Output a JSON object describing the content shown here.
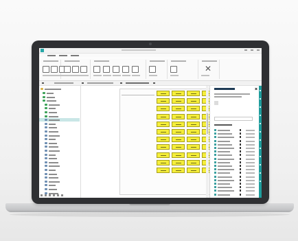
{
  "window": {
    "title": ""
  },
  "menu": {
    "items": [
      "",
      "",
      ""
    ]
  },
  "ribbon": {
    "groups": [
      {
        "label": "",
        "buttons": [
          "",
          "",
          ""
        ]
      },
      {
        "label": "",
        "buttons": [
          "",
          "",
          ""
        ]
      },
      {
        "label": "",
        "buttons": [
          "",
          "",
          "",
          "",
          ""
        ]
      },
      {
        "label": "",
        "buttons": [
          ""
        ]
      },
      {
        "label": "",
        "buttons": [
          ""
        ]
      },
      {
        "label": "",
        "buttons": [
          ""
        ]
      }
    ]
  },
  "address_bar": {
    "segments": [
      "",
      "",
      ""
    ]
  },
  "tree": {
    "root_label": "",
    "items": [
      "",
      "",
      "",
      "",
      "",
      "",
      "",
      "",
      "",
      "",
      "",
      "",
      "",
      "",
      "",
      "",
      "",
      "",
      "",
      "",
      "",
      "",
      "",
      "",
      "",
      "",
      ""
    ],
    "selected_index": 7
  },
  "canvas": {
    "grid_rows": 11,
    "grid_cols": 4,
    "cell_labels": []
  },
  "panel": {
    "title": "",
    "description": "",
    "search_placeholder": "",
    "section_heading": "",
    "rows": [
      {
        "label": "",
        "value": ""
      },
      {
        "label": "",
        "value": ""
      },
      {
        "label": "",
        "value": ""
      },
      {
        "label": "",
        "value": ""
      },
      {
        "label": "",
        "value": ""
      },
      {
        "label": "",
        "value": ""
      },
      {
        "label": "",
        "value": ""
      },
      {
        "label": "",
        "value": ""
      },
      {
        "label": "",
        "value": ""
      },
      {
        "label": "",
        "value": ""
      },
      {
        "label": "",
        "value": ""
      },
      {
        "label": "",
        "value": ""
      },
      {
        "label": "",
        "value": ""
      },
      {
        "label": "",
        "value": ""
      },
      {
        "label": "",
        "value": ""
      },
      {
        "label": "",
        "value": ""
      },
      {
        "label": "",
        "value": ""
      },
      {
        "label": "",
        "value": ""
      },
      {
        "label": "",
        "value": ""
      }
    ]
  },
  "colors": {
    "accent": "#1f9d9d",
    "cell_fill": "#f5ee3a",
    "cell_border": "#a79f18",
    "laptop_body": "#2f3033",
    "background": "#f4f4f4"
  },
  "icons": {
    "app": "app-logo-icon",
    "close_panel": "close-icon",
    "ribbon_delete": "x-icon"
  }
}
